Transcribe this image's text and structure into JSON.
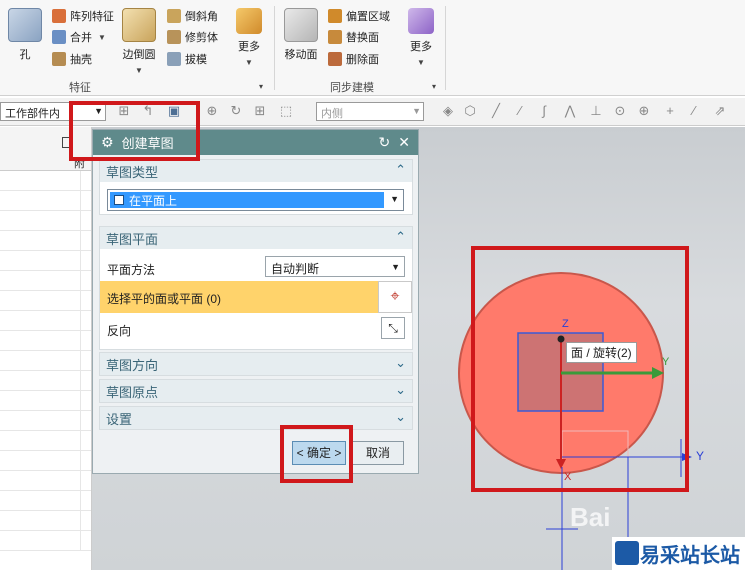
{
  "ribbon": {
    "hole_label": "孔",
    "pattern_feature": "阵列特征",
    "unite": "合并",
    "shell": "抽壳",
    "edge_blend": "边倒圆",
    "chamfer": "倒斜角",
    "trim_body": "修剪体",
    "draft": "拔模",
    "more1": "更多",
    "group1_label": "特征",
    "move_face": "移动面",
    "offset_region": "偏置区域",
    "replace_face": "替换面",
    "delete_face": "删除面",
    "more2": "更多",
    "group2_label": "同步建模"
  },
  "toolbar": {
    "selection_scope": "工作部件内",
    "filter_placeholder": "内侧"
  },
  "navigator": {
    "col_a": "附"
  },
  "dialog": {
    "title": "创建草图",
    "sec_type": "草图类型",
    "type_value": "在平面上",
    "sec_plane": "草图平面",
    "plane_method_label": "平面方法",
    "plane_method_value": "自动判断",
    "select_face_label": "选择平的面或平面 (0)",
    "reverse_label": "反向",
    "sec_orientation": "草图方向",
    "sec_origin": "草图原点",
    "sec_settings": "设置",
    "ok_label": "< 确定 >",
    "cancel_label": "取消"
  },
  "viewport": {
    "tooltip": "面 / 旋转(2)",
    "axis_z": "Z",
    "axis_y_inner": "Y",
    "axis_y_outer": "Y",
    "axis_x": "X",
    "watermark_brand": "Bai",
    "watermark_site": "易采站长站"
  },
  "colors": {
    "red_highlight": "#d0181b",
    "dialog_title_bg": "#5f8a8b",
    "selection_yellow": "#ffd36b",
    "circle_fill": "#ff7a6b"
  }
}
